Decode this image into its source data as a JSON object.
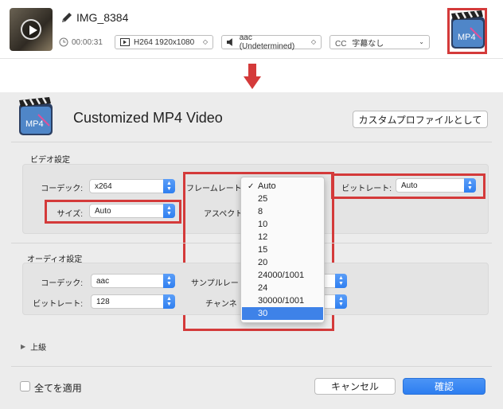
{
  "file": {
    "name": "IMG_8384",
    "duration": "00:00:31",
    "video_track": "H264 1920x1080",
    "audio_track": "aac (Undetermined)",
    "subtitle_track": "字幕なし",
    "subtitle_prefix": "CC"
  },
  "profile": {
    "title": "Customized MP4 Video",
    "icon_label": "MP4",
    "save_profile_button": "カスタムプロファイルとして"
  },
  "video_settings": {
    "section_label": "ビデオ設定",
    "codec_label": "コーデック:",
    "codec_value": "x264",
    "framerate_label": "フレームレート",
    "bitrate_label": "ビットレート:",
    "bitrate_value": "Auto",
    "size_label": "サイズ:",
    "size_value": "Auto",
    "aspect_label": "アスペクト"
  },
  "framerate_dropdown": {
    "options": [
      "Auto",
      "25",
      "8",
      "10",
      "12",
      "15",
      "20",
      "24000/1001",
      "24",
      "30000/1001",
      "30"
    ],
    "checked": "Auto",
    "highlighted": "30",
    "check_glyph": "✓"
  },
  "audio_settings": {
    "section_label": "オーディオ設定",
    "codec_label": "コーデック:",
    "codec_value": "aac",
    "samplerate_label": "サンプルレー",
    "bitrate_label": "ビットレート:",
    "bitrate_value": "128",
    "channel_label": "チャンネ"
  },
  "advanced": {
    "label": "上級"
  },
  "footer": {
    "apply_all_label": "全てを適用",
    "cancel_button": "キャンセル",
    "confirm_button": "確認"
  },
  "colors": {
    "highlight_red": "#d43a3a",
    "accent_blue": "#3e82e8"
  }
}
